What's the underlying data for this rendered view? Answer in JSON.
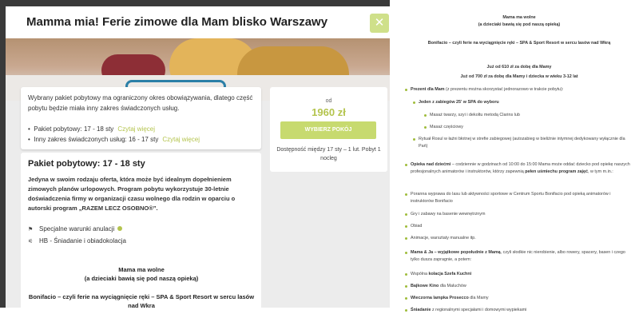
{
  "modal": {
    "title": "Mamma mia! Ferie zimowe dla Mam blisko Warszawy",
    "close_label": "✕",
    "info": {
      "text": "Wybrany pakiet pobytowy ma ograniczony okres obowiązywania, dlatego część pobytu będzie miała inny zakres świadczonych usług.",
      "items": [
        {
          "text": "Pakiet pobytowy: 17 - 18 sty",
          "link": "Czytaj więcej"
        },
        {
          "text": "Inny zakres świadczonych usług: 16 - 17 sty",
          "link": "Czytaj więcej"
        }
      ]
    },
    "price_box": {
      "label": "od",
      "price": "1960 zł",
      "button": "WYBIERZ POKÓJ",
      "availability": "Dostępność między 17 sty – 1 lut. Pobyt 1 nocleg"
    },
    "package": {
      "title": "Pakiet pobytowy: 17 - 18 sty",
      "description": "Jedyna w swoim rodzaju oferta, która może być idealnym dopełnieniem zimowych planów urlopowych. Program pobytu wykorzystuje 30-letnie doświadczenia firmy w organizacji czasu wolnego dla rodzin w oparciu o autorski program „RAZEM LECZ OSOBNO®”.",
      "feature_1": "Specjalne warunki anulacji",
      "feature_2": "HB - Śniadanie i obiadokolacja",
      "heading_1": "Mama ma wolne",
      "heading_2": "(a dzieciaki bawią się pod naszą opieką)",
      "heading_3": "Bonifacio – czyli ferie na wyciągnięcie ręki – SPA & Sport Resort w sercu lasów nad Wkrą"
    }
  },
  "right": {
    "h1": "Mama ma wolne",
    "h2": "(a dzieciaki bawią się pod naszą opieką)",
    "h3": "Bonifacio – czyli ferie na wyciągnięcie ręki – SPA & Sport Resort w sercu lasów nad Wkrą",
    "p1": "Już od 610 zł za dobę dla Mamy",
    "p2": "Już od 700 zł za dobę dla Mamy i dziecka w wieku 3-12 lat",
    "l1_b": "Prezent dla Mam",
    "l1_t": " (z prezentu można skorzystać jednorazowo w trakcie pobytu):",
    "l2": "Jeden z zabiegów 25' w SPA do wyboru",
    "l3": "Masaż twarzy, szyi i dekoltu metodą Clarins lub",
    "l4": "Masaż częściowy",
    "l5": "Rytuał Rosul w łaźni błotnej w strefie zabiegowej (autozabieg w bieliźnie intymnej dedykowany wyłącznie dla Pań)",
    "l6_b": "Opieka nad dziećmi",
    "l6_t": " – codziennie w godzinach od 10:00 do 15:00 Mama może oddać dziecko pod opiekę naszych profesjonalnych animatorów i instruktorów, którzy zapewnią ",
    "l6_b2": "pełen uśmiechu program zajęć",
    "l6_t2": ", w tym m.in.:",
    "l7": "Poranna wyprawa do lasu lub aktywności sportowe w Centrum Sportu Bonifacio pod opieką animatorów i instruktorów Bonifacio",
    "l8": "Gry i zabawy na basenie wewnętrznym",
    "l9": "Obiad",
    "l10": "Animacje, warsztaty manualne itp.",
    "l11_b": "Mama & Ja – wyjątkowe popołudnie z Mamą",
    "l11_t": ", czyli słodkie nic nierobienie, albo rowery, spacery, basen i czego tylko dusza zapragnie, a potem:",
    "l12_a": "Wspólna ",
    "l12_b": "kolacja Szefa Kuchni",
    "l13_b": "Bajkowe Kino",
    "l13_t": " dla Maluchów",
    "l14_b": "Wieczorna lampka Prosecco",
    "l14_t": "  dla Mamy",
    "l15_b": "Śniadanie",
    "l15_t": " z regionalnymi specjałami i domowymi wypiekami"
  }
}
